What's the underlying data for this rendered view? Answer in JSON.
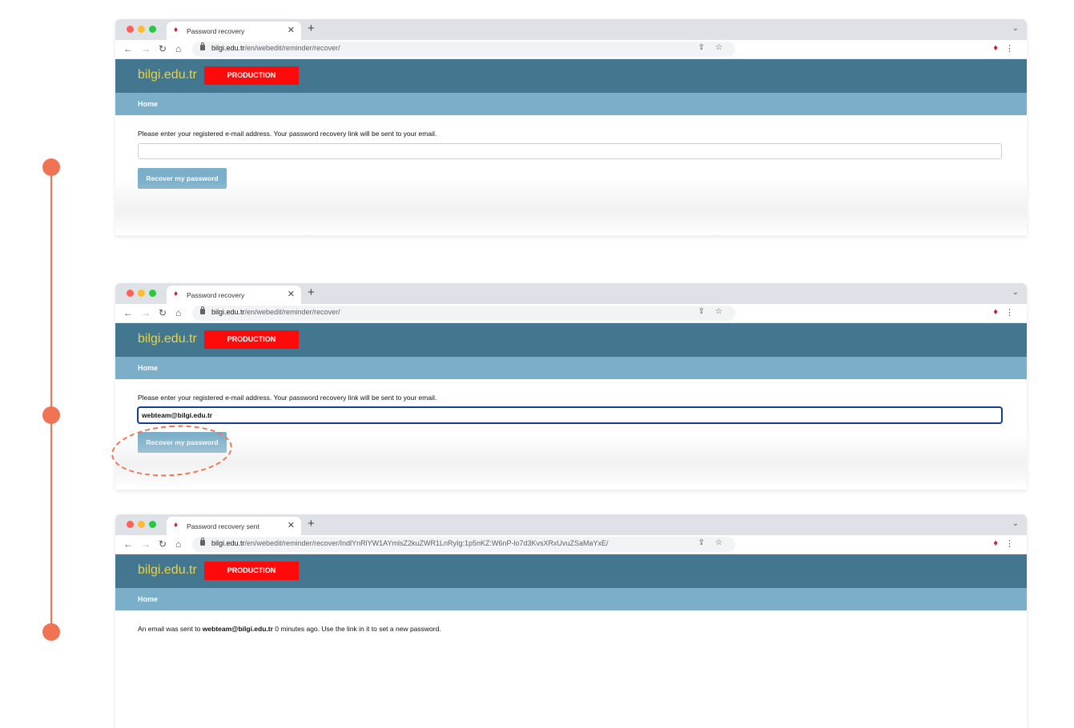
{
  "accent_color": "#f07454",
  "brand": {
    "header_color": "#43778f",
    "nav_color": "#7aaec9",
    "logo_color": "#e8d44a",
    "badge_color": "#ff0a0a"
  },
  "screens": [
    {
      "tab_title": "Password recovery",
      "url_host": "bilgi.edu.tr",
      "url_path": "/en/webedit/reminder/recover/",
      "site_logo": "bilgi.edu.tr",
      "env_badge": "PRODUCTION",
      "nav_home": "Home",
      "instructions": "Please enter your registered e-mail address. Your password recovery link will be sent to your email.",
      "email_value": "",
      "button_label": "Recover my password"
    },
    {
      "tab_title": "Password recovery",
      "url_host": "bilgi.edu.tr",
      "url_path": "/en/webedit/reminder/recover/",
      "site_logo": "bilgi.edu.tr",
      "env_badge": "PRODUCTION",
      "nav_home": "Home",
      "instructions": "Please enter your registered e-mail address. Your password recovery link will be sent to your email.",
      "email_value": "webteam@bilgi.edu.tr",
      "button_label": "Recover my password"
    },
    {
      "tab_title": "Password recovery sent",
      "url_host": "bilgi.edu.tr",
      "url_path": "/en/webedit/reminder/recover/IndlYnRlYW1AYmlsZ2kuZWR1LnRyIg:1p5nKZ:W6nP-lo7d3KvsXRxUvuZSaMaYxE/",
      "site_logo": "bilgi.edu.tr",
      "env_badge": "PRODUCTION",
      "nav_home": "Home",
      "sent_prefix": "An email was sent to ",
      "sent_email": "webteam@bilgi.edu.tr",
      "sent_suffix": " 0 minutes ago. Use the link in it to set a new password."
    }
  ],
  "icons": {
    "back": "arrow-left-icon",
    "forward": "arrow-right-icon",
    "reload": "reload-icon",
    "home": "home-icon",
    "lock": "lock-icon",
    "share": "share-icon",
    "bookmark": "star-icon",
    "extension": "extension-icon",
    "menu": "kebab-menu-icon"
  }
}
